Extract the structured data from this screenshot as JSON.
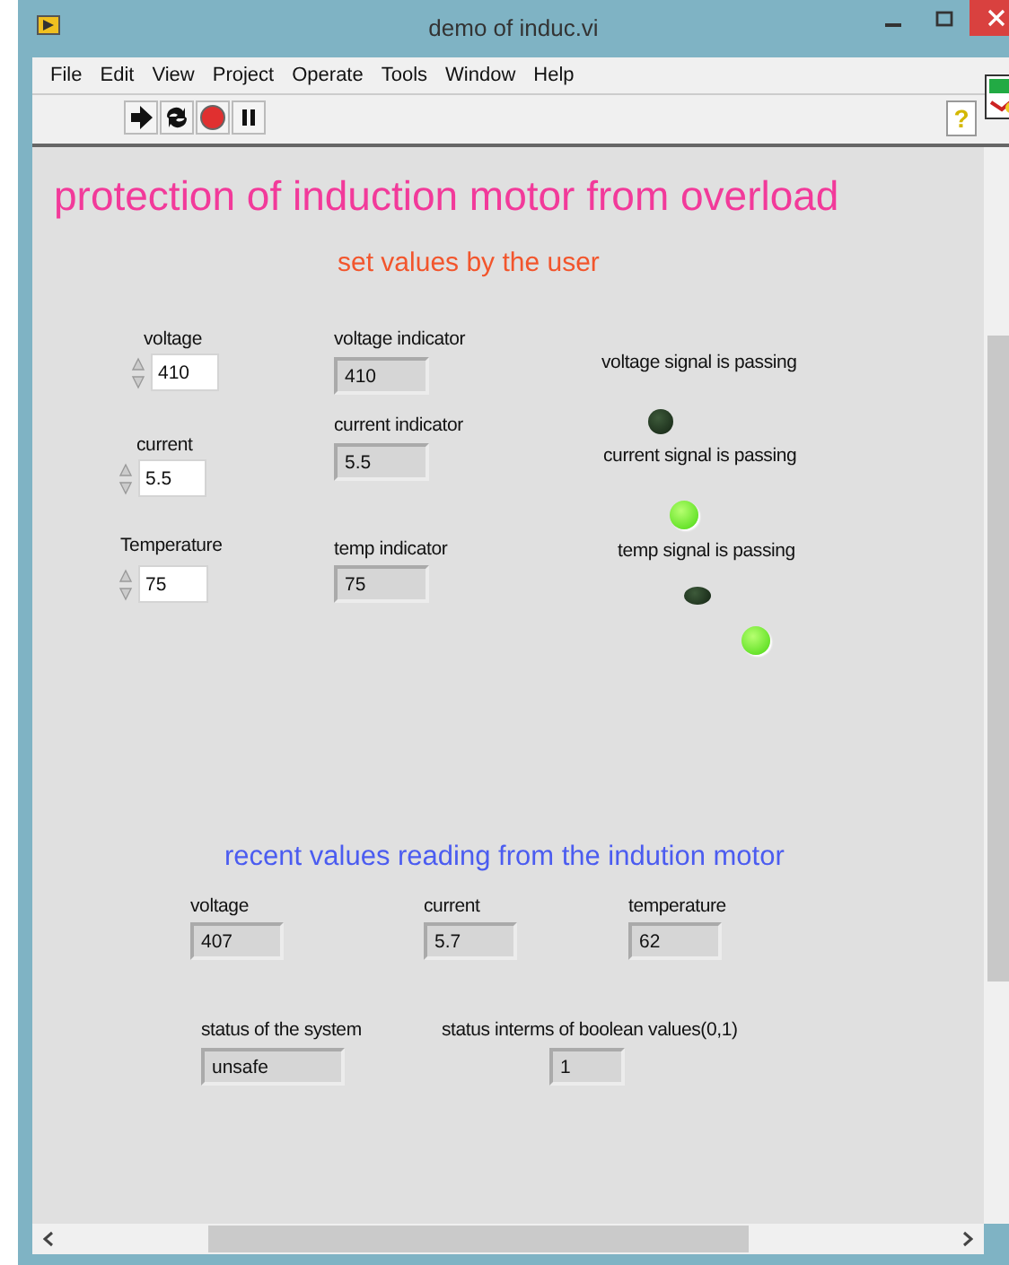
{
  "window": {
    "title": "demo of induc.vi"
  },
  "menu": [
    "File",
    "Edit",
    "View",
    "Project",
    "Operate",
    "Tools",
    "Window",
    "Help"
  ],
  "help_button": "?",
  "panel": {
    "title": "protection of induction motor from overload",
    "subtitle": "set values by the user",
    "controls": [
      {
        "label": "voltage",
        "value": "410"
      },
      {
        "label": "current",
        "value": "5.5"
      },
      {
        "label": "Temperature",
        "value": "75"
      }
    ],
    "indicators": [
      {
        "label": "voltage indicator",
        "value": "410"
      },
      {
        "label": "current indicator",
        "value": "5.5"
      },
      {
        "label": "temp indicator",
        "value": "75"
      }
    ],
    "signals": [
      "voltage signal is  passing",
      "current signal is  passing",
      "temp signal is  passing"
    ],
    "leds": [
      {
        "on": false
      },
      {
        "on": true
      },
      {
        "on": false
      },
      {
        "on": true
      }
    ],
    "readings_title": "recent values reading from the indution motor",
    "readings": [
      {
        "label": "voltage",
        "value": "407"
      },
      {
        "label": "current",
        "value": "5.7"
      },
      {
        "label": "temperature",
        "value": "62"
      }
    ],
    "status": [
      {
        "label": "status of the system",
        "value": "unsafe"
      },
      {
        "label": "status interms of boolean values(0,1)",
        "value": "1"
      }
    ]
  }
}
